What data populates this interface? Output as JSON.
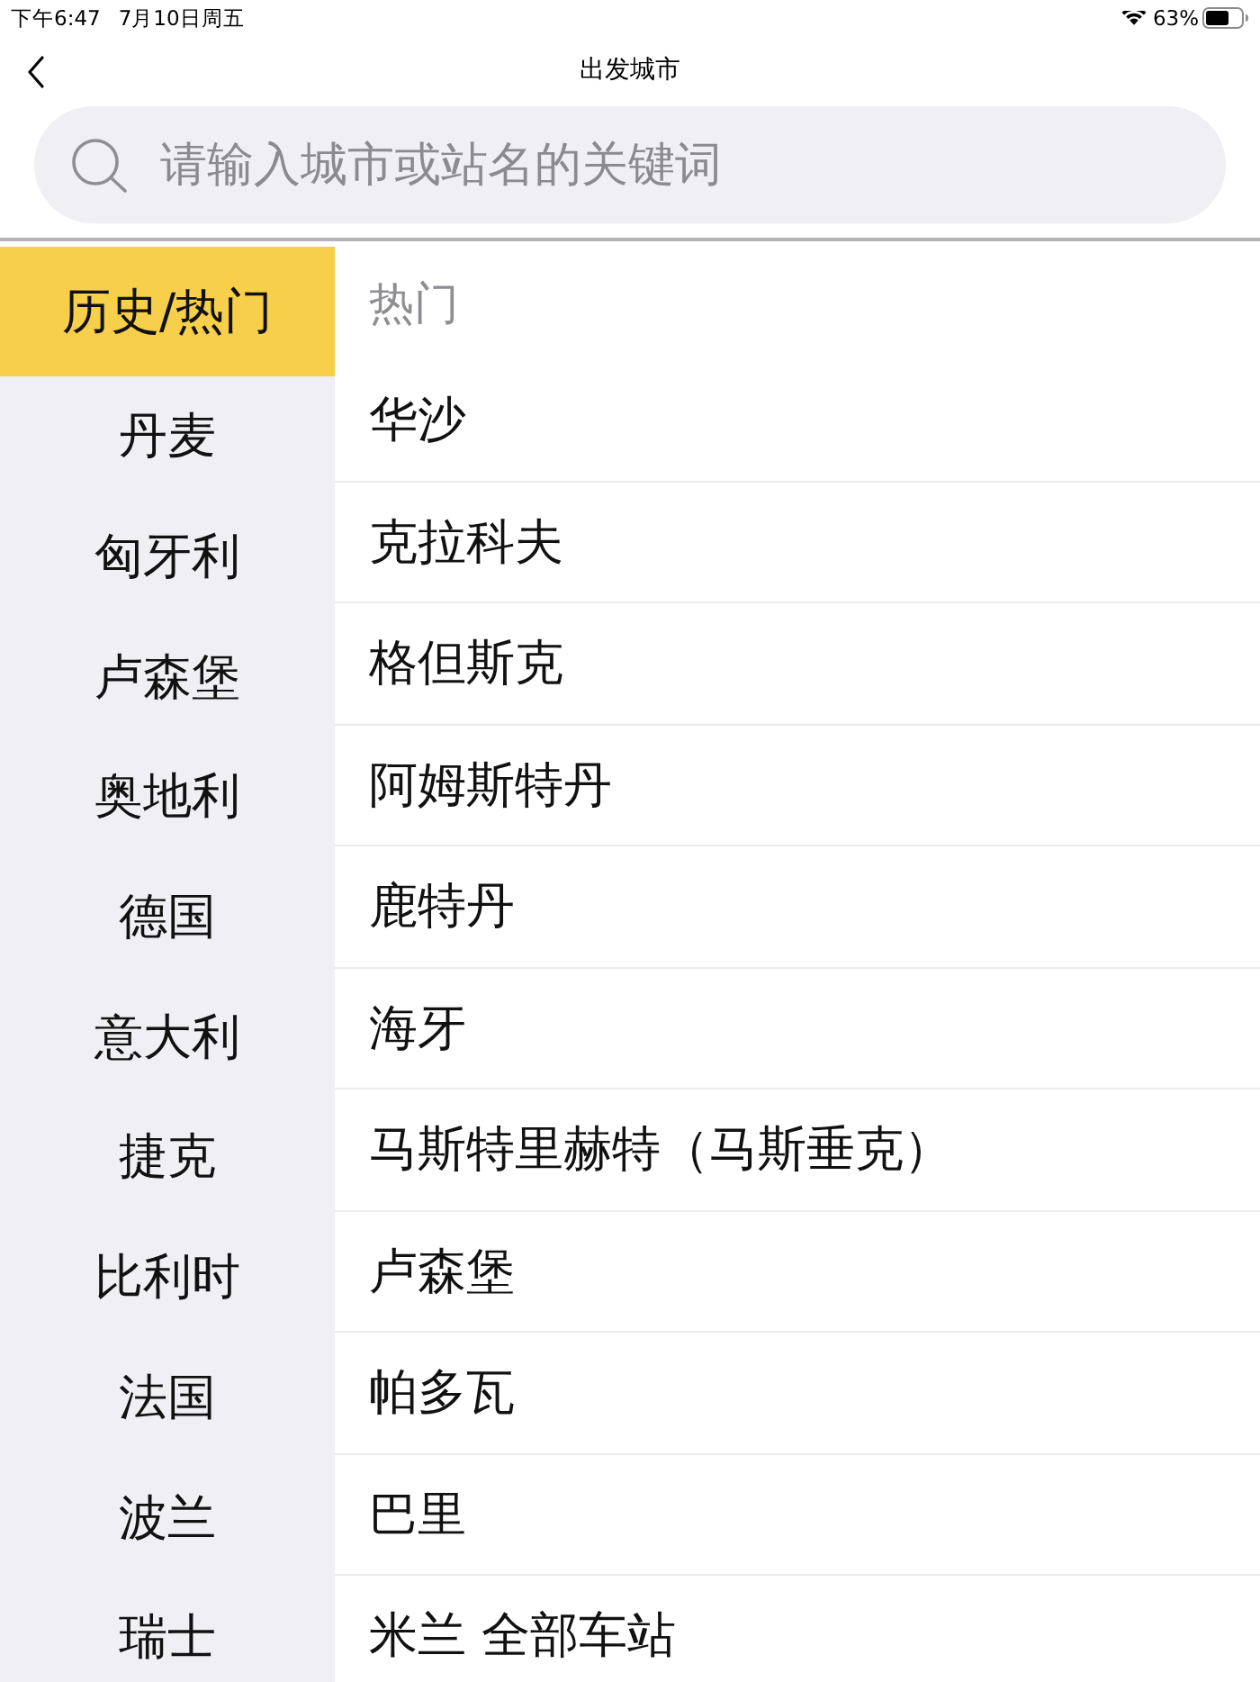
{
  "status_bar": {
    "time": "下午6:47",
    "date": "7月10日周五",
    "battery": "63%"
  },
  "nav": {
    "title": "出发城市"
  },
  "search": {
    "placeholder": "请输入城市或站名的关键词"
  },
  "sidebar": {
    "items": [
      {
        "label": "历史/热门",
        "selected": true
      },
      {
        "label": "丹麦",
        "selected": false
      },
      {
        "label": "匈牙利",
        "selected": false
      },
      {
        "label": "卢森堡",
        "selected": false
      },
      {
        "label": "奥地利",
        "selected": false
      },
      {
        "label": "德国",
        "selected": false
      },
      {
        "label": "意大利",
        "selected": false
      },
      {
        "label": "捷克",
        "selected": false
      },
      {
        "label": "比利时",
        "selected": false
      },
      {
        "label": "法国",
        "selected": false
      },
      {
        "label": "波兰",
        "selected": false
      },
      {
        "label": "瑞士",
        "selected": false
      }
    ]
  },
  "list": {
    "header": "热门",
    "rows": [
      "华沙",
      "克拉科夫",
      "格但斯克",
      "阿姆斯特丹",
      "鹿特丹",
      "海牙",
      "马斯特里赫特（马斯垂克）",
      "卢森堡",
      "帕多瓦",
      "巴里",
      "米兰 全部车站"
    ]
  }
}
